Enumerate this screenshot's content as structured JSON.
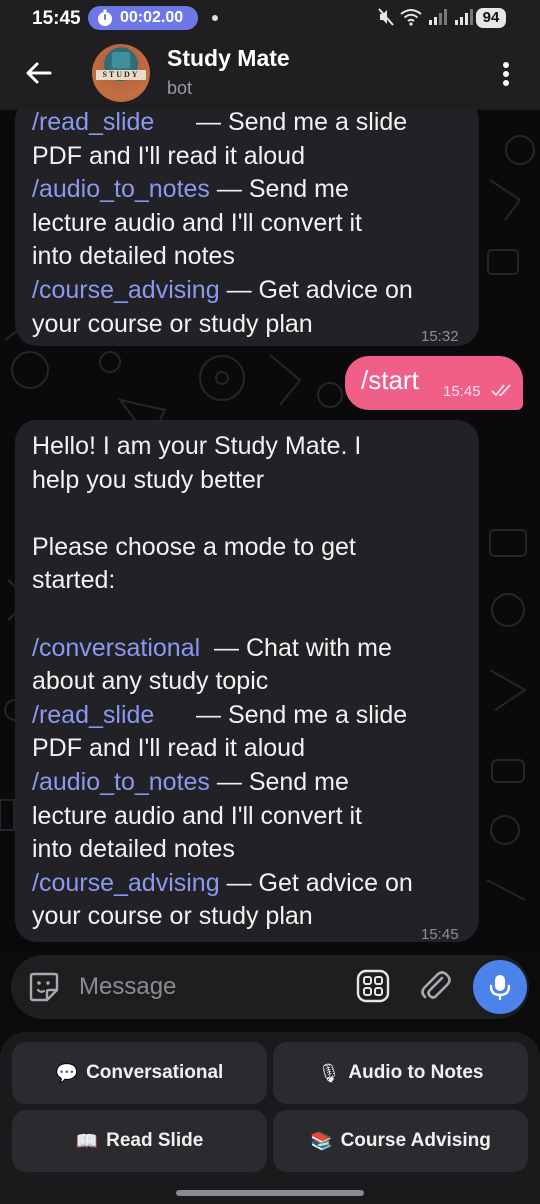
{
  "status_bar": {
    "time": "15:45",
    "timer": "00:02.00",
    "battery": "94"
  },
  "header": {
    "title": "Study Mate",
    "subtitle": "bot",
    "avatar_text": "STUDY"
  },
  "messages": [
    {
      "direction": "incoming",
      "time": "15:32",
      "lines": [
        {
          "cmd": "/read_slide",
          "pad": "     ",
          "text": " — Send me a slide"
        },
        {
          "cmd": "",
          "pad": "",
          "text": "PDF and I'll read it aloud"
        },
        {
          "cmd": "/audio_to_notes",
          "pad": "",
          "text": " — Send me"
        },
        {
          "cmd": "",
          "pad": "",
          "text": "lecture audio and I'll convert it"
        },
        {
          "cmd": "",
          "pad": "",
          "text": "into detailed notes"
        },
        {
          "cmd": "/course_advising",
          "pad": "",
          "text": " — Get advice on"
        },
        {
          "cmd": "",
          "pad": "",
          "text": "your course or study plan"
        }
      ]
    },
    {
      "direction": "outgoing",
      "text": "/start",
      "time": "15:45"
    },
    {
      "direction": "incoming",
      "time": "15:45",
      "lines": [
        {
          "cmd": "",
          "pad": "",
          "text": "Hello! I am your Study Mate. I"
        },
        {
          "cmd": "",
          "pad": "",
          "text": "help you study better"
        },
        {
          "cmd": "",
          "pad": "",
          "text": ""
        },
        {
          "cmd": "",
          "pad": "",
          "text": "Please choose a mode to get"
        },
        {
          "cmd": "",
          "pad": "",
          "text": "started:"
        },
        {
          "cmd": "",
          "pad": "",
          "text": ""
        },
        {
          "cmd": "/conversational",
          "pad": " ",
          "text": " — Chat with me"
        },
        {
          "cmd": "",
          "pad": "",
          "text": "about any study topic"
        },
        {
          "cmd": "/read_slide",
          "pad": "     ",
          "text": " — Send me a slide"
        },
        {
          "cmd": "",
          "pad": "",
          "text": "PDF and I'll read it aloud"
        },
        {
          "cmd": "/audio_to_notes",
          "pad": "",
          "text": " — Send me"
        },
        {
          "cmd": "",
          "pad": "",
          "text": "lecture audio and I'll convert it"
        },
        {
          "cmd": "",
          "pad": "",
          "text": "into detailed notes"
        },
        {
          "cmd": "/course_advising",
          "pad": "",
          "text": " — Get advice on"
        },
        {
          "cmd": "",
          "pad": "",
          "text": "your course or study plan"
        }
      ]
    }
  ],
  "input": {
    "placeholder": "Message",
    "value": ""
  },
  "keyboard_buttons": [
    {
      "icon": "💬",
      "icon_name": "speech-balloon-icon",
      "label": "Conversational"
    },
    {
      "icon": "🎙",
      "icon_name": "microphone-icon",
      "label": "Audio to Notes"
    },
    {
      "icon": "📖",
      "icon_name": "open-book-icon",
      "label": "Read Slide"
    },
    {
      "icon": "📚",
      "icon_name": "books-icon",
      "label": "Course Advising"
    }
  ],
  "colors": {
    "accent": "#4c83ea",
    "outgoing_bubble": "#ef5f88",
    "command_link": "#8b98f0",
    "timer_pill": "#6d78e6"
  }
}
